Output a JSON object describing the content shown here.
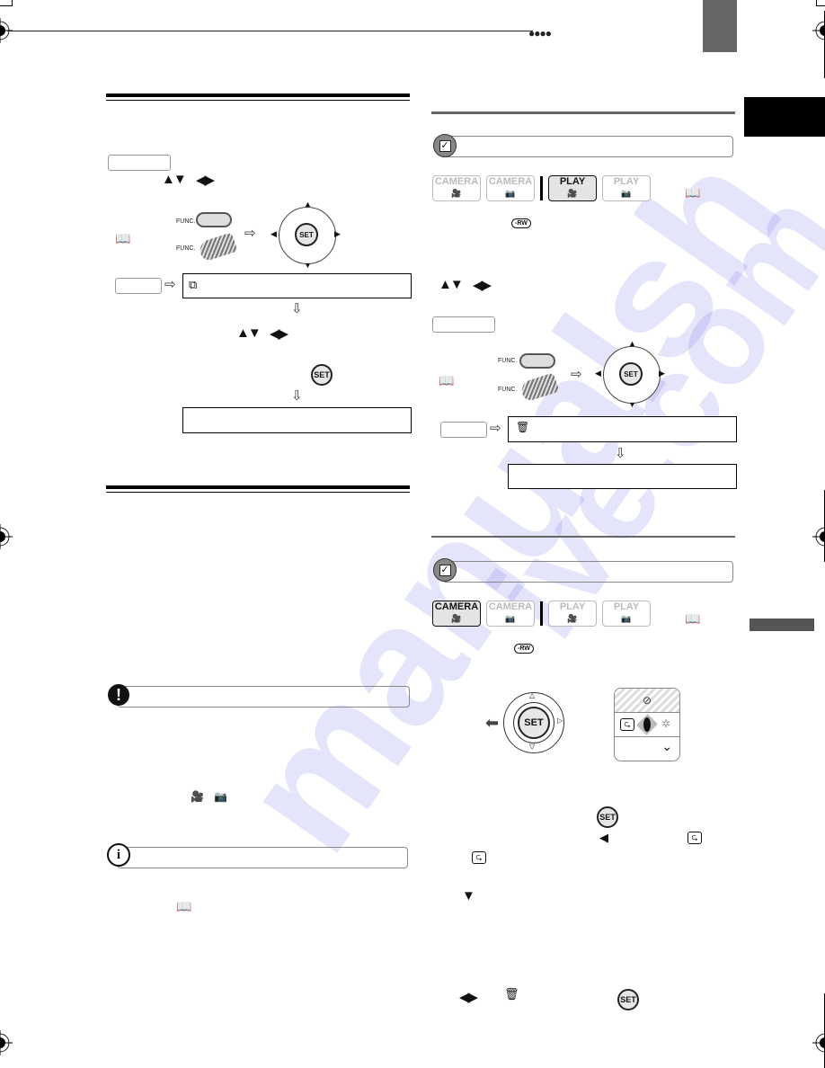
{
  "page": {
    "header_marker": "●●●●",
    "watermark_text": "manualsh ive.com"
  },
  "icons": {
    "book_ref": "📖",
    "arrow_right": "⇨",
    "arrow_down": "⇩",
    "tri_up_down": "▲▼",
    "tri_left_right": "◀▶",
    "tri_left": "◀",
    "tri_down": "▼",
    "set_label": "SET",
    "func_label": "FUNC.",
    "rw_label": "-RW",
    "check_mark": "✓",
    "warning_mark": "!",
    "info_mark": "i",
    "loop_mark": "⮎",
    "trash_mark": "🗑",
    "movie_camera_mark": "🎥",
    "photo_camera_mark": "📷",
    "chevron_down": "⌄"
  },
  "left_column": {
    "section1": {
      "menu_path_arrow": "⇨",
      "menu_item_icon": "⧉"
    }
  },
  "right_column": {
    "section1": {
      "modes": [
        {
          "label": "CAMERA",
          "sub": "🎥",
          "active": false
        },
        {
          "label": "CAMERA",
          "sub": "📷",
          "active": false
        },
        {
          "label": "PLAY",
          "sub": "🎥",
          "active": true
        },
        {
          "label": "PLAY",
          "sub": "📷",
          "active": false
        }
      ],
      "menu_item_icon": "🗑"
    },
    "section2": {
      "modes": [
        {
          "label": "CAMERA",
          "sub": "🎥",
          "active": true
        },
        {
          "label": "CAMERA",
          "sub": "📷",
          "active": false
        },
        {
          "label": "PLAY",
          "sub": "🎥",
          "active": false
        },
        {
          "label": "PLAY",
          "sub": "📷",
          "active": false
        }
      ]
    }
  }
}
